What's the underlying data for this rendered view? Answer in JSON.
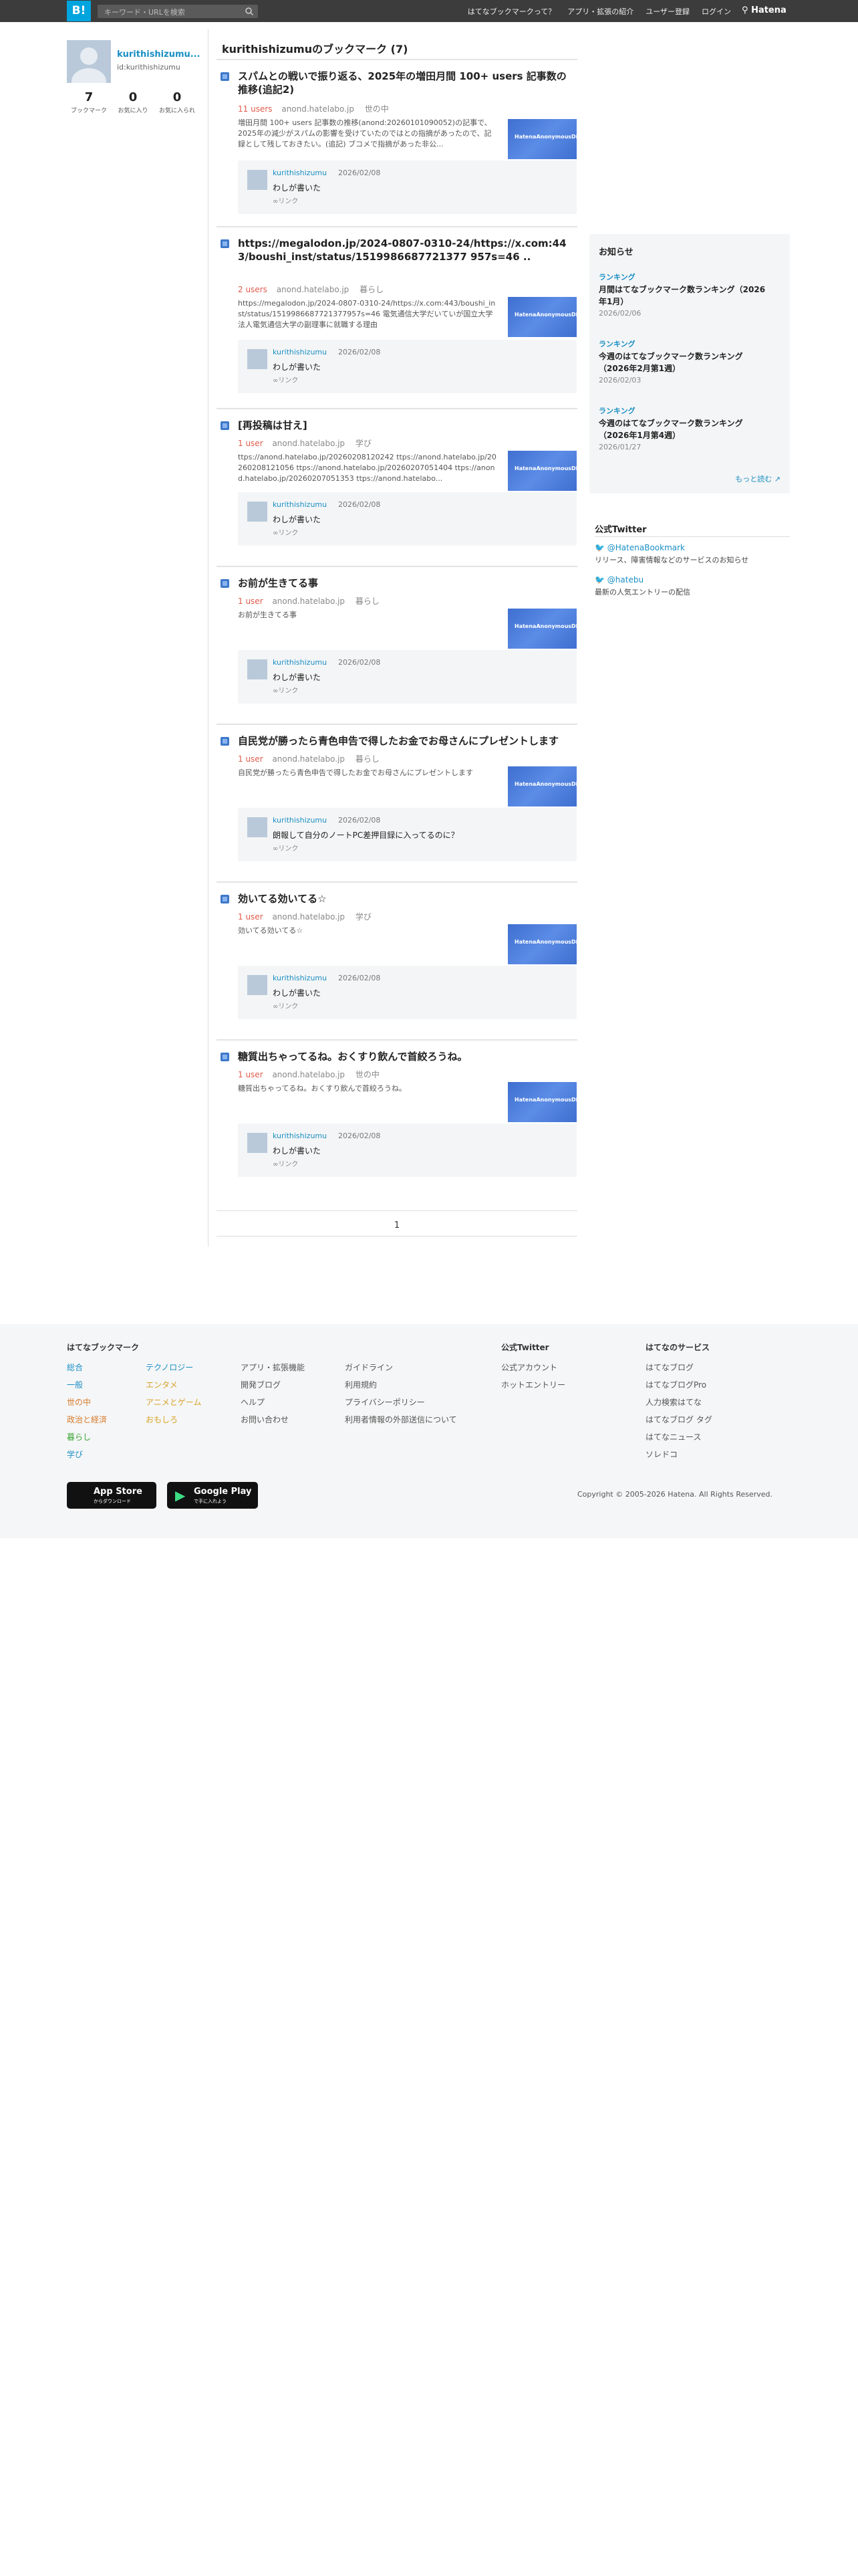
{
  "topbar": {
    "logo": "B!",
    "search_placeholder": "キーワード・URLを検索",
    "nav": [
      "はてなブックマークって？",
      "アプリ・拡張の紹介",
      "ユーザー登録",
      "ログイン"
    ],
    "brand": "Hatena"
  },
  "profile": {
    "name": "kurithishizumu...",
    "id": "id:kurithishizumu",
    "stats": [
      {
        "num": "7",
        "label": "ブックマーク"
      },
      {
        "num": "0",
        "label": "お気に入り"
      },
      {
        "num": "0",
        "label": "お気に入られ"
      }
    ]
  },
  "page_title": "kurithishizumuのブックマーク (7)",
  "thumb_text": "HatenaAnonymousDiary",
  "entries": [
    {
      "title": "スパムとの戦いで振り返る、2025年の増田月間 100+ users 記事数の推移(追記2)",
      "users": "11 users",
      "domain": "anond.hatelabo.jp",
      "category": "世の中",
      "summary": "増田月間 100+ users 記事数の推移(anond:20260101090052)の記事で、2025年の減少がスパムの影響を受けていたのではとの指摘があったので、記録として残しておきたい。(追記) ブコメで指摘があった非公...",
      "comment": {
        "user": "kurithishizumu",
        "date": "2026/02/08",
        "text": "わしが書いた",
        "link": "∞リンク"
      }
    },
    {
      "title": "https://megalodon.jp/2024-0807-0310-24/https://x.com:443/boushi_inst/status/1519986687721377 957s=46 ..",
      "users": "2 users",
      "domain": "anond.hatelabo.jp",
      "category": "暮らし",
      "summary": "https://megalodon.jp/2024-0807-0310-24/https://x.com:443/boushi_inst/status/1519986687721377957s=46 電気通信大学だいていが国立大学法人電気通信大学の副理事に就職する理由",
      "comment": {
        "user": "kurithishizumu",
        "date": "2026/02/08",
        "text": "わしが書いた",
        "link": "∞リンク"
      }
    },
    {
      "title": "[再投稿は甘え]",
      "users": "1 user",
      "domain": "anond.hatelabo.jp",
      "category": "学び",
      "summary": "ttps://anond.hatelabo.jp/20260208120242 ttps://anond.hatelabo.jp/20260208121056 ttps://anond.hatelabo.jp/20260207051404 ttps://anond.hatelabo.jp/20260207051353 ttps://anond.hatelabo...",
      "comment": {
        "user": "kurithishizumu",
        "date": "2026/02/08",
        "text": "わしが書いた",
        "link": "∞リンク"
      }
    },
    {
      "title": "お前が生きてる事",
      "users": "1 user",
      "domain": "anond.hatelabo.jp",
      "category": "暮らし",
      "summary": "お前が生きてる事",
      "comment": {
        "user": "kurithishizumu",
        "date": "2026/02/08",
        "text": "わしが書いた",
        "link": "∞リンク"
      }
    },
    {
      "title": "自民党が勝ったら青色申告で得したお金でお母さんにプレゼントします",
      "users": "1 user",
      "domain": "anond.hatelabo.jp",
      "category": "暮らし",
      "summary": "自民党が勝ったら青色申告で得したお金でお母さんにプレゼントします",
      "comment": {
        "user": "kurithishizumu",
        "date": "2026/02/08",
        "text": "朗報して自分のノートPC差押目録に入ってるのに？",
        "link": "∞リンク"
      }
    },
    {
      "title": "効いてる効いてる☆",
      "users": "1 user",
      "domain": "anond.hatelabo.jp",
      "category": "学び",
      "summary": "効いてる効いてる☆",
      "comment": {
        "user": "kurithishizumu",
        "date": "2026/02/08",
        "text": "わしが書いた",
        "link": "∞リンク"
      }
    },
    {
      "title": "糖質出ちゃってるね。おくすり飲んで首絞ろうね。",
      "users": "1 user",
      "domain": "anond.hatelabo.jp",
      "category": "世の中",
      "summary": "糖質出ちゃってるね。おくすり飲んで首絞ろうね。",
      "comment": {
        "user": "kurithishizumu",
        "date": "2026/02/08",
        "text": "わしが書いた",
        "link": "∞リンク"
      }
    }
  ],
  "pagination": "1",
  "news": {
    "title": "お知らせ",
    "items": [
      {
        "category": "ランキング",
        "text": "月間はてなブックマーク数ランキング（2026年1月）",
        "date": "2026/02/06"
      },
      {
        "category": "ランキング",
        "text": "今週のはてなブックマーク数ランキング（2026年2月第1週）",
        "date": "2026/02/03"
      },
      {
        "category": "ランキング",
        "text": "今週のはてなブックマーク数ランキング（2026年1月第4週）",
        "date": "2026/01/27"
      }
    ],
    "more": "もっと読む"
  },
  "twitter": {
    "title": "公式Twitter",
    "items": [
      {
        "handle": "@HatenaBookmark",
        "desc": "リリース、障害情報などのサービスのお知らせ"
      },
      {
        "handle": "@hatebu",
        "desc": "最新の人気エントリーの配信"
      }
    ]
  },
  "footer": {
    "title": "はてなブックマーク",
    "cats1": [
      "総合",
      "一般",
      "世の中",
      "政治と経済",
      "暮らし",
      "学び"
    ],
    "cats2": [
      "テクノロジー",
      "エンタメ",
      "アニメとゲーム",
      "おもしろ"
    ],
    "links1": [
      "アプリ・拡張機能",
      "開発ブログ",
      "ヘルプ",
      "お問い合わせ"
    ],
    "links2": [
      "ガイドライン",
      "利用規約",
      "プライバシーポリシー",
      "利用者情報の外部送信について"
    ],
    "twitter_title": "公式Twitter",
    "twitter_links": [
      "公式アカウント",
      "ホットエントリー"
    ],
    "services_title": "はてなのサービス",
    "services": [
      "はてなブログ",
      "はてなブログPro",
      "人力検索はてな",
      "はてなブログ タグ",
      "はてなニュース",
      "ソレドコ"
    ],
    "appstore_top": "App Store",
    "appstore_sub": "からダウンロード",
    "googleplay_top": "Google Play",
    "googleplay_sub": "で手に入れよう",
    "copyright": "Copyright © 2005-2026 Hatena. All Rights Reserved."
  },
  "colors": {
    "accent": "#00a4de",
    "link": "#1a8fc4",
    "users": "#e05b4b",
    "topbar": "#3c3c3c"
  }
}
